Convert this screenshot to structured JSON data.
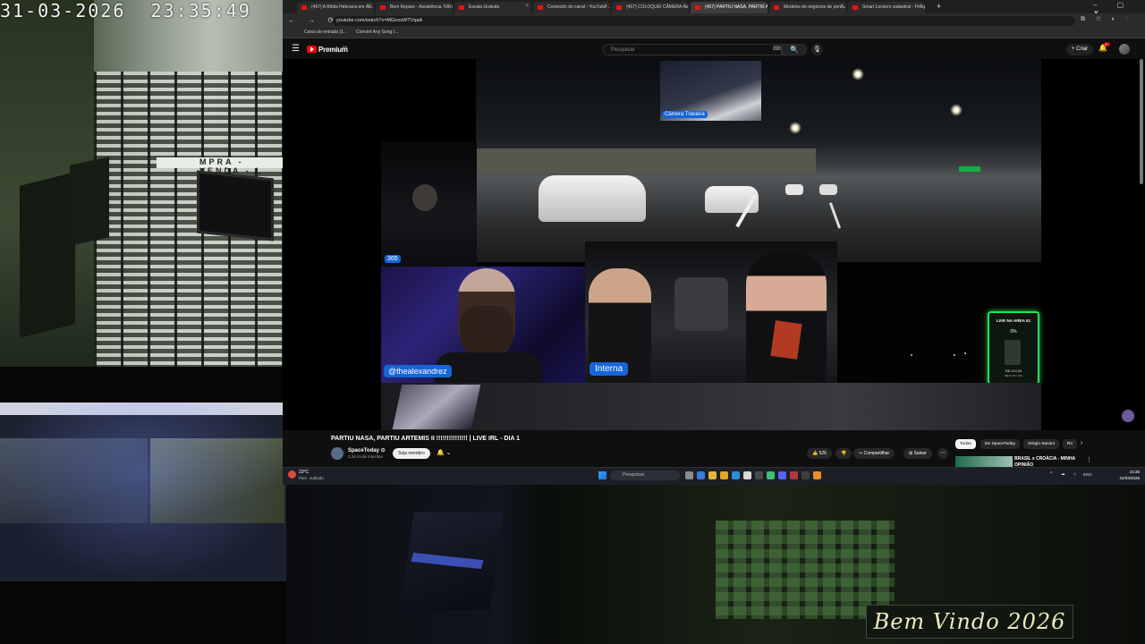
{
  "cctv": {
    "timestamp": "31-03-2026  23:35:49",
    "store_sign": "MPRA - VENDA - L"
  },
  "browser": {
    "tabs": [
      {
        "label": "(457) A Bíblia Hebraica em Áu..."
      },
      {
        "label": "Bom Reparo - Assistência Técni..."
      },
      {
        "label": "Escala Gratuita"
      },
      {
        "label": "Conteúdo do canal - YouTube ..."
      },
      {
        "label": "(457) COLOQUEI CÂMERA na ..."
      },
      {
        "label": "(457) PARTIU NASA, PARTIU AR..."
      },
      {
        "label": "Modelos de negócios de pontu..."
      },
      {
        "label": "Smart Lockers cadastrat - Pesq..."
      }
    ],
    "new_tab": "+",
    "window_controls": "– ▢ ✕",
    "url": "youtube.com/watch?v=MGnosWTVqaA",
    "nav_buttons": "← → ⟳",
    "addr_icons": "⧉ ☆ ◐ ⋮",
    "bookmarks": [
      {
        "label": "Caixa de entrada (1..."
      },
      {
        "label": "Convert Any Song t..."
      }
    ]
  },
  "youtube": {
    "menu_icon": "☰",
    "logo_text": "Premium",
    "logo_region": "BR",
    "search_placeholder": "Pesquisar",
    "search_kbd": "⌨",
    "search_button": "🔍",
    "mic": "🎙",
    "create_button": "+ Criar",
    "bell": "🔔",
    "bell_badge": "9+"
  },
  "stream": {
    "rear_camera_label": "Câmera Traseira",
    "cam365_label": "365",
    "streamer_label": "@thealexandrez",
    "interior_label": "Interna",
    "live_card": {
      "title": "LIVE NA AREA 51",
      "percent": "0%",
      "progress": 0,
      "amount": "R$ 410,00",
      "sub": "META DA LIVE"
    }
  },
  "video": {
    "title": "PARTIU NASA, PARTIU ARTEMIS II !!!!!!!!!!!!!!! | LIVE IRL - DIA 1",
    "channel": "SpaceToday ⊙",
    "subscribers": "2,24 mi de inscritos",
    "join_button": "Seja membro",
    "bell": "🔔 ⌄",
    "like_count": "👍 526",
    "dislike": "👎",
    "share_button": "↪ Compartilhar",
    "save_button": "⊞ Salvar",
    "more": "⋯"
  },
  "recommendations": {
    "chips": [
      {
        "label": "Todos"
      },
      {
        "label": "De SpaceToday"
      },
      {
        "label": "Sérgio Sacani"
      },
      {
        "label": "Ro"
      }
    ],
    "next": "›",
    "first_title": "BRASIL x CROÁCIA - MINHA OPINIÃO",
    "menu": "⋮"
  },
  "taskbar": {
    "temperature": "23°C",
    "weather": "Parc. nublado",
    "search_placeholder": "Pesquisar",
    "tray_icons": "^ ☁ ⌂",
    "language": "ENG",
    "time": "23:35",
    "date": "31/03/2026"
  },
  "overlay": {
    "welcome_text": "Bem Vindo 2026"
  },
  "colors": {
    "youtube_red": "#ff0000",
    "label_blue": "#1565d8",
    "live_green": "#22e05a"
  }
}
